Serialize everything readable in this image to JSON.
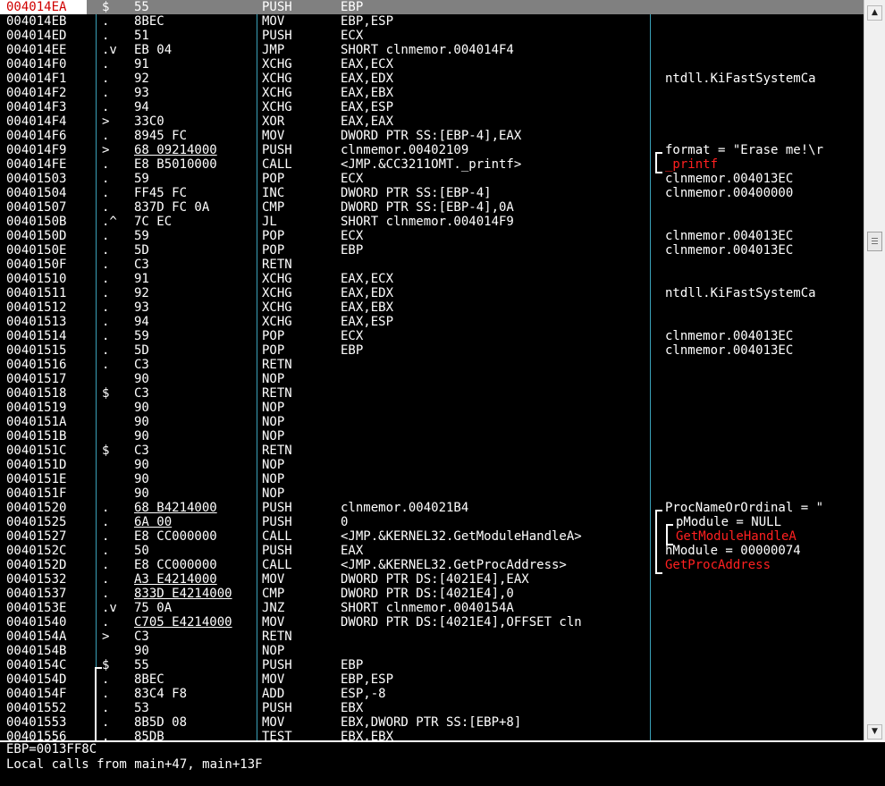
{
  "disasm": {
    "rows": [
      {
        "addr": "004014EA",
        "mk": "$",
        "hex": "55",
        "mn": "PUSH",
        "op": "EBP",
        "cm": "",
        "sel": true
      },
      {
        "addr": "004014EB",
        "mk": ".",
        "hex": "8BEC",
        "mn": "MOV",
        "op": "EBP,ESP",
        "cm": ""
      },
      {
        "addr": "004014ED",
        "mk": ".",
        "hex": "51",
        "mn": "PUSH",
        "op": "ECX",
        "cm": ""
      },
      {
        "addr": "004014EE",
        "mk": ".v",
        "hex": "EB 04",
        "mn": "JMP",
        "op": "SHORT clnmemor.004014F4",
        "cm": ""
      },
      {
        "addr": "004014F0",
        "mk": ".",
        "hex": "91",
        "mn": "XCHG",
        "op": "EAX,ECX",
        "cm": ""
      },
      {
        "addr": "004014F1",
        "mk": ".",
        "hex": "92",
        "mn": "XCHG",
        "op": "EAX,EDX",
        "cm": "ntdll.KiFastSystemCa"
      },
      {
        "addr": "004014F2",
        "mk": ".",
        "hex": "93",
        "mn": "XCHG",
        "op": "EAX,EBX",
        "cm": ""
      },
      {
        "addr": "004014F3",
        "mk": ".",
        "hex": "94",
        "mn": "XCHG",
        "op": "EAX,ESP",
        "cm": ""
      },
      {
        "addr": "004014F4",
        "mk": ">",
        "hex": "33C0",
        "mn": "XOR",
        "op": "EAX,EAX",
        "cm": ""
      },
      {
        "addr": "004014F6",
        "mk": ".",
        "hex": "8945 FC",
        "mn": "MOV",
        "op": "DWORD PTR SS:[EBP-4],EAX",
        "cm": ""
      },
      {
        "addr": "004014F9",
        "mk": ">",
        "hex": "68 09214000",
        "hexu": true,
        "mn": "PUSH",
        "op": "clnmemor.00402109",
        "cm": "format = \"Erase me!\\r"
      },
      {
        "addr": "004014FE",
        "mk": ".",
        "hex": "E8 B5010000",
        "mn": "CALL",
        "op": "<JMP.&CC3211OMT._printf>",
        "cm": "_printf",
        "cmred": true
      },
      {
        "addr": "00401503",
        "mk": ".",
        "hex": "59",
        "mn": "POP",
        "op": "ECX",
        "cm": "clnmemor.004013EC"
      },
      {
        "addr": "00401504",
        "mk": ".",
        "hex": "FF45 FC",
        "mn": "INC",
        "op": "DWORD PTR SS:[EBP-4]",
        "cm": "clnmemor.00400000"
      },
      {
        "addr": "00401507",
        "mk": ".",
        "hex": "837D FC 0A",
        "mn": "CMP",
        "op": "DWORD PTR SS:[EBP-4],0A",
        "cm": ""
      },
      {
        "addr": "0040150B",
        "mk": ".^",
        "hex": "7C EC",
        "mn": "JL",
        "op": "SHORT clnmemor.004014F9",
        "cm": ""
      },
      {
        "addr": "0040150D",
        "mk": ".",
        "hex": "59",
        "mn": "POP",
        "op": "ECX",
        "cm": "clnmemor.004013EC"
      },
      {
        "addr": "0040150E",
        "mk": ".",
        "hex": "5D",
        "mn": "POP",
        "op": "EBP",
        "cm": "clnmemor.004013EC"
      },
      {
        "addr": "0040150F",
        "mk": ".",
        "hex": "C3",
        "mn": "RETN",
        "op": "",
        "cm": ""
      },
      {
        "addr": "00401510",
        "mk": ".",
        "hex": "91",
        "mn": "XCHG",
        "op": "EAX,ECX",
        "cm": ""
      },
      {
        "addr": "00401511",
        "mk": ".",
        "hex": "92",
        "mn": "XCHG",
        "op": "EAX,EDX",
        "cm": "ntdll.KiFastSystemCa"
      },
      {
        "addr": "00401512",
        "mk": ".",
        "hex": "93",
        "mn": "XCHG",
        "op": "EAX,EBX",
        "cm": ""
      },
      {
        "addr": "00401513",
        "mk": ".",
        "hex": "94",
        "mn": "XCHG",
        "op": "EAX,ESP",
        "cm": ""
      },
      {
        "addr": "00401514",
        "mk": ".",
        "hex": "59",
        "mn": "POP",
        "op": "ECX",
        "cm": "clnmemor.004013EC"
      },
      {
        "addr": "00401515",
        "mk": ".",
        "hex": "5D",
        "mn": "POP",
        "op": "EBP",
        "cm": "clnmemor.004013EC"
      },
      {
        "addr": "00401516",
        "mk": ".",
        "hex": "C3",
        "mn": "RETN",
        "op": "",
        "cm": ""
      },
      {
        "addr": "00401517",
        "mk": "",
        "hex": "90",
        "mn": "NOP",
        "op": "",
        "cm": ""
      },
      {
        "addr": "00401518",
        "mk": "$",
        "hex": "C3",
        "mn": "RETN",
        "op": "",
        "cm": ""
      },
      {
        "addr": "00401519",
        "mk": "",
        "hex": "90",
        "mn": "NOP",
        "op": "",
        "cm": ""
      },
      {
        "addr": "0040151A",
        "mk": "",
        "hex": "90",
        "mn": "NOP",
        "op": "",
        "cm": ""
      },
      {
        "addr": "0040151B",
        "mk": "",
        "hex": "90",
        "mn": "NOP",
        "op": "",
        "cm": ""
      },
      {
        "addr": "0040151C",
        "mk": "$",
        "hex": "C3",
        "mn": "RETN",
        "op": "",
        "cm": ""
      },
      {
        "addr": "0040151D",
        "mk": "",
        "hex": "90",
        "mn": "NOP",
        "op": "",
        "cm": ""
      },
      {
        "addr": "0040151E",
        "mk": "",
        "hex": "90",
        "mn": "NOP",
        "op": "",
        "cm": ""
      },
      {
        "addr": "0040151F",
        "mk": "",
        "hex": "90",
        "mn": "NOP",
        "op": "",
        "cm": ""
      },
      {
        "addr": "00401520",
        "mk": ".",
        "hex": "68 B4214000",
        "hexu": true,
        "mn": "PUSH",
        "op": "clnmemor.004021B4",
        "cm": "ProcNameOrOrdinal = \""
      },
      {
        "addr": "00401525",
        "mk": ".",
        "hex": "6A 00",
        "hexu": true,
        "mn": "PUSH",
        "op": "0",
        "cm": "pModule = NULL"
      },
      {
        "addr": "00401527",
        "mk": ".",
        "hex": "E8 CC000000",
        "mn": "CALL",
        "op": "<JMP.&KERNEL32.GetModuleHandleA>",
        "cm": "GetModuleHandleA",
        "cmred": true
      },
      {
        "addr": "0040152C",
        "mk": ".",
        "hex": "50",
        "mn": "PUSH",
        "op": "EAX",
        "cm": "hModule = 00000074"
      },
      {
        "addr": "0040152D",
        "mk": ".",
        "hex": "E8 CC000000",
        "mn": "CALL",
        "op": "<JMP.&KERNEL32.GetProcAddress>",
        "cm": "GetProcAddress",
        "cmred": true
      },
      {
        "addr": "00401532",
        "mk": ".",
        "hex": "A3 E4214000",
        "hexu": true,
        "mn": "MOV",
        "op": "DWORD PTR DS:[4021E4],EAX",
        "cm": ""
      },
      {
        "addr": "00401537",
        "mk": ".",
        "hex": "833D E4214000",
        "hexu": true,
        "mn": "CMP",
        "op": "DWORD PTR DS:[4021E4],0",
        "cm": ""
      },
      {
        "addr": "0040153E",
        "mk": ".v",
        "hex": "75 0A",
        "mn": "JNZ",
        "op": "SHORT clnmemor.0040154A",
        "cm": ""
      },
      {
        "addr": "00401540",
        "mk": ".",
        "hex": "C705 E4214000",
        "hexu": true,
        "mn": "MOV",
        "op": "DWORD PTR DS:[4021E4],OFFSET cln",
        "cm": ""
      },
      {
        "addr": "0040154A",
        "mk": ">",
        "hex": "C3",
        "mn": "RETN",
        "op": "",
        "cm": ""
      },
      {
        "addr": "0040154B",
        "mk": "",
        "hex": "90",
        "mn": "NOP",
        "op": "",
        "cm": ""
      },
      {
        "addr": "0040154C",
        "mk": "$",
        "hex": "55",
        "mn": "PUSH",
        "op": "EBP",
        "cm": ""
      },
      {
        "addr": "0040154D",
        "mk": ".",
        "hex": "8BEC",
        "mn": "MOV",
        "op": "EBP,ESP",
        "cm": ""
      },
      {
        "addr": "0040154F",
        "mk": ".",
        "hex": "83C4 F8",
        "mn": "ADD",
        "op": "ESP,-8",
        "cm": ""
      },
      {
        "addr": "00401552",
        "mk": ".",
        "hex": "53",
        "mn": "PUSH",
        "op": "EBX",
        "cm": ""
      },
      {
        "addr": "00401553",
        "mk": ".",
        "hex": "8B5D 08",
        "mn": "MOV",
        "op": "EBX,DWORD PTR SS:[EBP+8]",
        "cm": ""
      },
      {
        "addr": "00401556",
        "mk": ".",
        "hex": "85DB",
        "mn": "TEST",
        "op": "EBX,EBX",
        "cm": ""
      }
    ]
  },
  "info": {
    "line1": "EBP=0013FF8C",
    "line2": "Local calls from main+47, main+13F"
  },
  "scrollbar": {
    "up_icon": "▲",
    "down_icon": "▼"
  },
  "colors": {
    "background": "#000000",
    "text": "#ffffff",
    "highlight": "#ff2020",
    "selection": "#808080",
    "separator": "#3aa0b8"
  }
}
